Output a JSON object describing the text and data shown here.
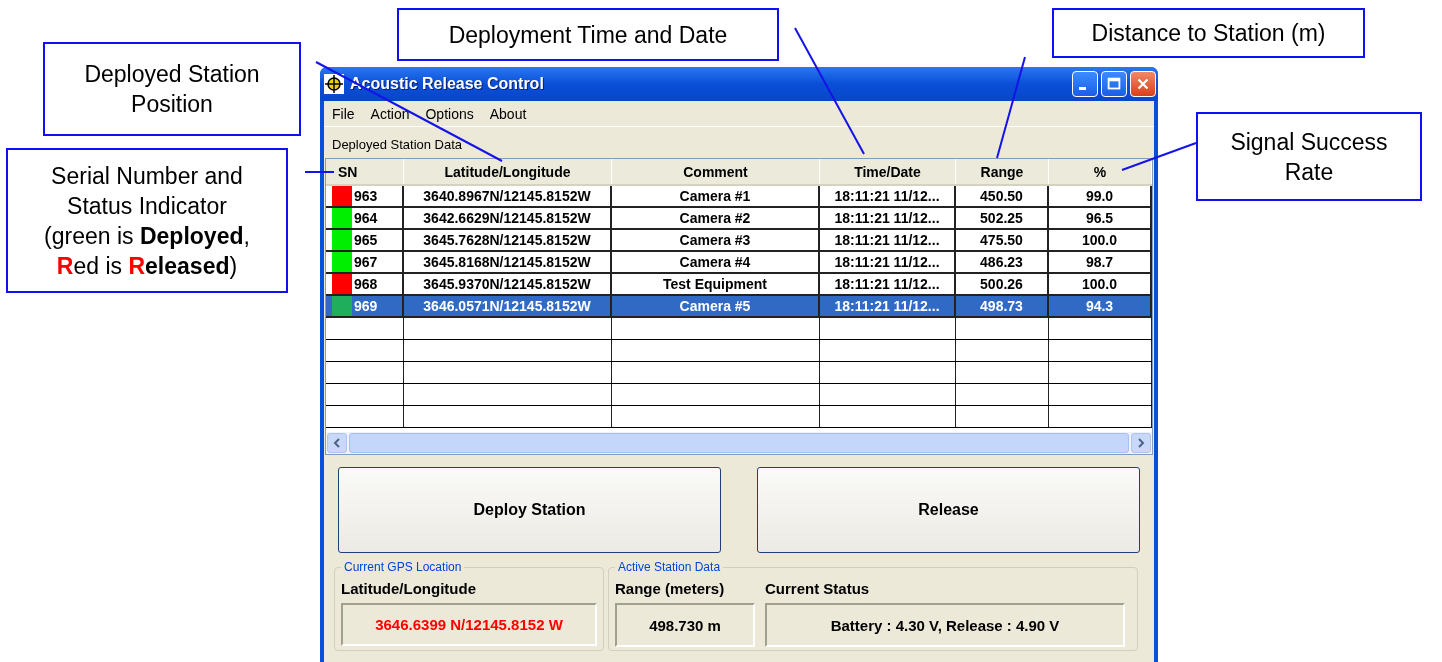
{
  "callouts": [
    {
      "kind": "station-position",
      "lines": [
        [
          {
            "text": "Deployed Station"
          }
        ],
        [
          {
            "text": "Position"
          }
        ]
      ]
    },
    {
      "kind": "serial-status",
      "lines": [
        [
          {
            "text": "Serial Number and"
          }
        ],
        [
          {
            "text": "Status Indicator"
          }
        ],
        [
          {
            "text": "(green is "
          },
          {
            "text": "Deployed",
            "bold": true
          },
          {
            "text": ","
          }
        ],
        [
          {
            "text": "R",
            "bold": true,
            "color": "#ff0000"
          },
          {
            "text": "ed is "
          },
          {
            "text": "R",
            "bold": true,
            "color": "#ff0000"
          },
          {
            "text": "eleased",
            "bold": true
          },
          {
            "text": ")"
          }
        ]
      ]
    },
    {
      "kind": "time-date",
      "lines": [
        [
          {
            "text": "Deployment Time and Date"
          }
        ]
      ]
    },
    {
      "kind": "distance",
      "lines": [
        [
          {
            "text": "Distance to Station (m)"
          }
        ]
      ]
    },
    {
      "kind": "success-rate",
      "lines": [
        [
          {
            "text": "Signal Success"
          }
        ],
        [
          {
            "text": "Rate"
          }
        ]
      ]
    }
  ],
  "window": {
    "title": "Acoustic Release Control"
  },
  "menu": [
    "File",
    "Action",
    "Options",
    "About"
  ],
  "section_label": "Deployed Station Data",
  "table": {
    "columns": [
      "SN",
      "Latitude/Longitude",
      "Comment",
      "Time/Date",
      "Range",
      "%"
    ],
    "rows": [
      {
        "sn": "963",
        "color": "#ff0000",
        "position": "3640.8967N/12145.8152W",
        "comment": "Camera #1",
        "time": "18:11:21 11/12...",
        "range": "450.50",
        "rate": "99.0",
        "selected": false
      },
      {
        "sn": "964",
        "color": "#00ee00",
        "position": "3642.6629N/12145.8152W",
        "comment": "Camera #2",
        "time": "18:11:21 11/12...",
        "range": "502.25",
        "rate": "96.5",
        "selected": false
      },
      {
        "sn": "965",
        "color": "#00ee00",
        "position": "3645.7628N/12145.8152W",
        "comment": "Camera #3",
        "time": "18:11:21 11/12...",
        "range": "475.50",
        "rate": "100.0",
        "selected": false
      },
      {
        "sn": "967",
        "color": "#00ee00",
        "position": "3645.8168N/12145.8152W",
        "comment": "Camera #4",
        "time": "18:11:21 11/12...",
        "range": "486.23",
        "rate": "98.7",
        "selected": false
      },
      {
        "sn": "968",
        "color": "#ff0000",
        "position": "3645.9370N/12145.8152W",
        "comment": "Test Equipment",
        "time": "18:11:21 11/12...",
        "range": "500.26",
        "rate": "100.0",
        "selected": false
      },
      {
        "sn": "969",
        "color": "#1fae5c",
        "position": "3646.0571N/12145.8152W",
        "comment": "Camera #5",
        "time": "18:11:21 11/12...",
        "range": "498.73",
        "rate": "94.3",
        "selected": true
      }
    ]
  },
  "buttons": [
    "Deploy Station",
    "Release"
  ],
  "gps_group": {
    "legend": "Current GPS Location",
    "label": "Latitude/Longitude",
    "value": "3646.6399 N/12145.8152 W"
  },
  "station_group": {
    "legend": "Active Station Data",
    "range_label": "Range (meters)",
    "range_value": "498.730 m",
    "status_label": "Current Status",
    "status_value": "Battery : 4.30 V, Release : 4.90 V"
  }
}
